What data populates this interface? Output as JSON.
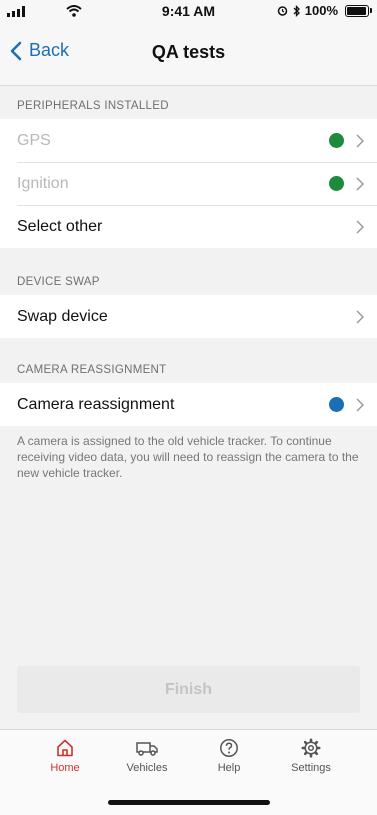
{
  "status_bar": {
    "time": "9:41 AM",
    "battery": "100%"
  },
  "nav": {
    "back_label": "Back",
    "title": "QA tests"
  },
  "sections": {
    "peripherals": {
      "header": "PERIPHERALS INSTALLED",
      "rows": [
        {
          "label": "GPS",
          "status_color": "#1e8a3c"
        },
        {
          "label": "Ignition",
          "status_color": "#1e8a3c"
        },
        {
          "label": "Select other"
        }
      ]
    },
    "device_swap": {
      "header": "DEVICE SWAP",
      "rows": [
        {
          "label": "Swap device"
        }
      ]
    },
    "camera": {
      "header": "CAMERA REASSIGNMENT",
      "rows": [
        {
          "label": "Camera reassignment",
          "status_color": "#1b6fb5"
        }
      ],
      "info": "A camera is assigned to the old vehicle tracker. To continue receiving video data, you will need to reassign the camera to the new vehicle tracker."
    }
  },
  "finish_button": {
    "label": "Finish"
  },
  "tabbar": {
    "items": [
      {
        "label": "Home",
        "icon": "home-icon",
        "active": true
      },
      {
        "label": "Vehicles",
        "icon": "van-icon"
      },
      {
        "label": "Help",
        "icon": "help-icon"
      },
      {
        "label": "Settings",
        "icon": "gear-icon"
      }
    ]
  },
  "colors": {
    "accent": "#1b6fb5",
    "active_tab": "#d0312d",
    "ok": "#1e8a3c",
    "info": "#1b6fb5"
  }
}
